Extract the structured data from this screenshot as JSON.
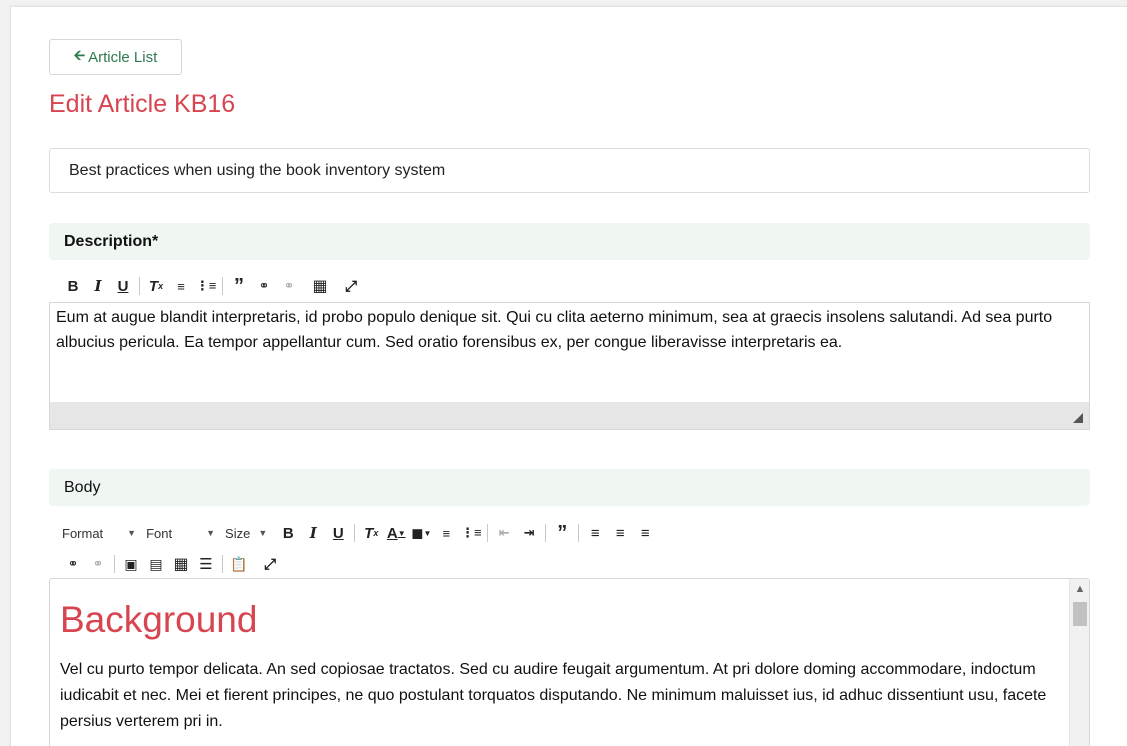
{
  "back_button": {
    "icon": "arrow-left-icon",
    "label": "Article List"
  },
  "page_title": "Edit Article KB16",
  "title_field": {
    "value": "Best practices when using the book inventory  system"
  },
  "description": {
    "label": "Description*",
    "text": "Eum at augue blandit interpretaris, id probo populo denique sit. Qui cu clita aeterno minimum, sea at graecis insolens salutandi. Ad sea purto albucius pericula. Ea tempor appellantur cum. Sed oratio forensibus ex, per congue liberavisse interpretaris ea."
  },
  "body": {
    "label": "Body",
    "toolbar": {
      "format": "Format",
      "font": "Font",
      "size": "Size"
    },
    "heading": "Background",
    "paragraph": "Vel cu purto tempor delicata. An sed copiosae tractatos. Sed cu audire feugait argumentum. At pri dolore doming accommodare, indoctum iudicabit et nec. Mei et fierent principes, ne quo postulant torquatos disputando. Ne minimum maluisset ius, id adhuc dissentiunt usu, facete persius verterem pri in."
  },
  "colors": {
    "accent_red": "#d64550",
    "link_green": "#2e7a4f",
    "label_bg": "#f0f6f2"
  }
}
